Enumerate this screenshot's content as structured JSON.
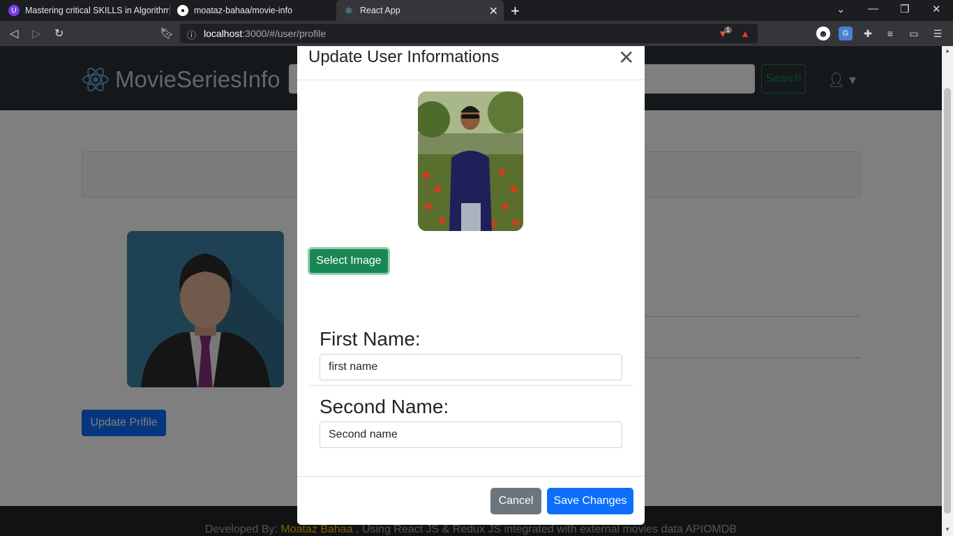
{
  "browser": {
    "tabs": [
      {
        "title": "Mastering critical SKILLS in Algorithms",
        "active": false
      },
      {
        "title": "moataz-bahaa/movie-info",
        "active": false
      },
      {
        "title": "React App",
        "active": true
      }
    ],
    "url_host": "localhost",
    "url_path": ":3000/#/user/profile",
    "extension_badge": "1"
  },
  "app": {
    "brand": "MovieSeriesInfo",
    "search_button": "Search",
    "update_profile_button": "Update Prifile"
  },
  "footer": {
    "prefix": "Developed By: ",
    "author": "Moataz Bahaa",
    "suffix": " , Using React JS & Redux JS integrated with external movies data APIOMDB"
  },
  "modal": {
    "title": "Update User Informations",
    "select_image_button": "Select Image",
    "first_name_label": "First Name:",
    "first_name_placeholder": "first name",
    "second_name_label": "Second Name:",
    "second_name_placeholder": "Second name",
    "cancel_button": "Cancel",
    "save_button": "Save Changes"
  },
  "colors": {
    "primary": "#0d6efd",
    "success": "#198754",
    "secondary": "#6c757d",
    "navbar": "#2b3035",
    "footer_accent": "#ffc107"
  }
}
